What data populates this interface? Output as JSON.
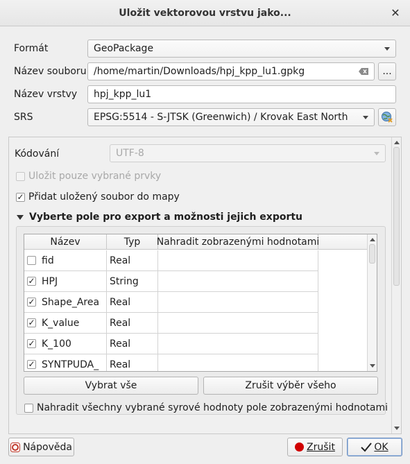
{
  "window": {
    "title": "Uložit vektorovou vrstvu jako..."
  },
  "form": {
    "format_label": "Formát",
    "format_value": "GeoPackage",
    "filename_label": "Název souboru",
    "filename_value": "/home/martin/Downloads/hpj_kpp_lu1.gpkg",
    "browse_label": "...",
    "layer_label": "Název vrstvy",
    "layer_value": "hpj_kpp_lu1",
    "srs_label": "SRS",
    "srs_value": "EPSG:5514 - S-JTSK (Greenwich) / Krovak East North"
  },
  "options": {
    "encoding_label": "Kódování",
    "encoding_value": "UTF-8",
    "save_selected_label": "Uložit pouze vybrané prvky",
    "save_selected_checked": false,
    "add_to_map_label": "Přidat uložený soubor do mapy",
    "add_to_map_checked": true,
    "fields_section_label": "Vyberte pole pro export a možnosti jejich exportu"
  },
  "fields_table": {
    "columns": [
      "Název",
      "Typ",
      "Nahradit zobrazenými hodnotami"
    ],
    "rows": [
      {
        "checked": false,
        "name": "fid",
        "type": "Real"
      },
      {
        "checked": true,
        "name": "HPJ",
        "type": "String"
      },
      {
        "checked": true,
        "name": "Shape_Area",
        "type": "Real"
      },
      {
        "checked": true,
        "name": "K_value",
        "type": "Real"
      },
      {
        "checked": true,
        "name": "K_100",
        "type": "Real"
      },
      {
        "checked": true,
        "name": "SYNTPUDA_",
        "type": "Real"
      }
    ]
  },
  "fields_actions": {
    "select_all": "Vybrat vše",
    "deselect_all": "Zrušit výběr všeho",
    "replace_all_label": "Nahradit všechny vybrané syrové hodnoty pole zobrazenými hodnotami"
  },
  "footer": {
    "help_label": "Nápověda",
    "cancel_label": "Zrušit",
    "ok_label": "OK"
  },
  "colors": {
    "accent": "#6c8fbf",
    "cancel_icon": "#d00000",
    "help_icon": "#c0392b"
  }
}
